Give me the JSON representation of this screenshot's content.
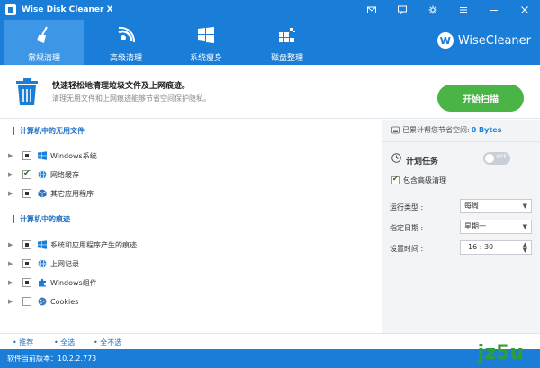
{
  "app": {
    "title": "Wise Disk Cleaner X"
  },
  "nav": {
    "tabs": [
      {
        "label": "常规清理",
        "icon": "broom-icon"
      },
      {
        "label": "高级清理",
        "icon": "advanced-clean-icon"
      },
      {
        "label": "系统瘦身",
        "icon": "windows-icon"
      },
      {
        "label": "磁盘整理",
        "icon": "defrag-icon"
      }
    ],
    "active_tab": 0,
    "brand": "WiseCleaner"
  },
  "banner": {
    "title": "快速轻松地清理垃圾文件及上网痕迹。",
    "subtitle": "清理无用文件和上网痕迹能够节省空间保护隐私。",
    "scan_button": "开始扫描"
  },
  "left": {
    "section1": "计算机中的无用文件",
    "items1": [
      {
        "label": "Windows系统",
        "state": "partial",
        "icon": "windows-icon"
      },
      {
        "label": "网络缓存",
        "state": "checked",
        "icon": "globe-icon"
      },
      {
        "label": "其它应用程序",
        "state": "partial",
        "icon": "box-icon"
      }
    ],
    "section2": "计算机中的痕迹",
    "items2": [
      {
        "label": "系统和应用程序产生的痕迹",
        "state": "partial",
        "icon": "windows-icon"
      },
      {
        "label": "上网记录",
        "state": "partial",
        "icon": "globe-icon"
      },
      {
        "label": "Windows组件",
        "state": "partial",
        "icon": "puzzle-icon"
      },
      {
        "label": "Cookies",
        "state": "unchecked",
        "icon": "cookie-icon"
      }
    ]
  },
  "right": {
    "saved_label": "已累计帮您节省空间:",
    "saved_value": "0 Bytes",
    "schedule_title": "计划任务",
    "toggle_label": "OFF",
    "include_advanced": "包含高级清理",
    "run_type_label": "运行类型 :",
    "run_type_value": "每周",
    "day_label": "指定日期 :",
    "day_value": "星期一",
    "time_label": "设置时间 :",
    "time_value": "16 : 30"
  },
  "bottom": {
    "links": [
      "推荐",
      "全选",
      "全不选"
    ],
    "version": "软件当前版本：10.2.2.773",
    "watermark": "jz5u"
  },
  "colors": {
    "primary": "#1a7dd7",
    "scan": "#4bb446"
  }
}
